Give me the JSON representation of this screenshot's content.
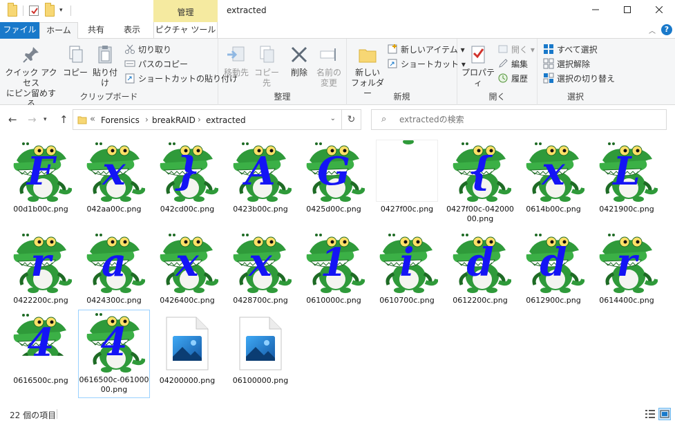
{
  "window": {
    "title": "extracted",
    "picture_tools": "管理"
  },
  "tabs": {
    "file": "ファイル",
    "home": "ホーム",
    "share": "共有",
    "view": "表示",
    "picture_tools": "ピクチャ ツール"
  },
  "ribbon": {
    "clipboard": {
      "label": "クリップボード",
      "pin": "クイック アクセス\nにピン留めする",
      "copy": "コピー",
      "paste": "貼り付け",
      "cut": "切り取り",
      "copy_path": "パスのコピー",
      "paste_shortcut": "ショートカットの貼り付け"
    },
    "organize": {
      "label": "整理",
      "move_to": "移動先",
      "copy_to": "コピー先",
      "delete": "削除",
      "rename": "名前の\n変更"
    },
    "new": {
      "label": "新規",
      "new_folder": "新しい\nフォルダー",
      "new_item": "新しいアイテム",
      "shortcut": "ショートカット"
    },
    "open": {
      "label": "開く",
      "properties": "プロパティ",
      "open": "開く",
      "edit": "編集",
      "history": "履歴"
    },
    "select": {
      "label": "選択",
      "select_all": "すべて選択",
      "select_none": "選択解除",
      "invert": "選択の切り替え"
    }
  },
  "address": {
    "prefix": "«",
    "crumbs": [
      "Forensics",
      "breakRAID",
      "extracted"
    ],
    "search_placeholder": "extractedの検索"
  },
  "files": [
    {
      "name": "00d1b00c.png",
      "glyph": "F"
    },
    {
      "name": "042aa00c.png",
      "glyph": "x"
    },
    {
      "name": "042cd00c.png",
      "glyph": "}"
    },
    {
      "name": "0423b00c.png",
      "glyph": "A"
    },
    {
      "name": "0425d00c.png",
      "glyph": "G"
    },
    {
      "name": "0427f00c.png",
      "glyph": ""
    },
    {
      "name": "0427f00c-04200000.png",
      "glyph": "{"
    },
    {
      "name": "0614b00c.png",
      "glyph": "x"
    },
    {
      "name": "0421900c.png",
      "glyph": "L"
    },
    {
      "name": "0422200c.png",
      "glyph": "r"
    },
    {
      "name": "0424300c.png",
      "glyph": "a"
    },
    {
      "name": "0426400c.png",
      "glyph": "x"
    },
    {
      "name": "0428700c.png",
      "glyph": "x"
    },
    {
      "name": "0610000c.png",
      "glyph": "1"
    },
    {
      "name": "0610700c.png",
      "glyph": "i"
    },
    {
      "name": "0612200c.png",
      "glyph": "d"
    },
    {
      "name": "0612900c.png",
      "glyph": "d"
    },
    {
      "name": "0614400c.png",
      "glyph": "r"
    },
    {
      "name": "0616500c.png",
      "glyph": "4"
    },
    {
      "name": "0616500c-06100000.png",
      "glyph": "4"
    },
    {
      "name": "04200000.png",
      "glyph": ""
    },
    {
      "name": "06100000.png",
      "glyph": ""
    }
  ],
  "status": {
    "count": "22 個の項目"
  },
  "colors": {
    "accent": "#1979ca",
    "glyph": "#1414f5",
    "croc_green": "#2f9a3a",
    "picture_tools_band": "#f5eaa0"
  }
}
